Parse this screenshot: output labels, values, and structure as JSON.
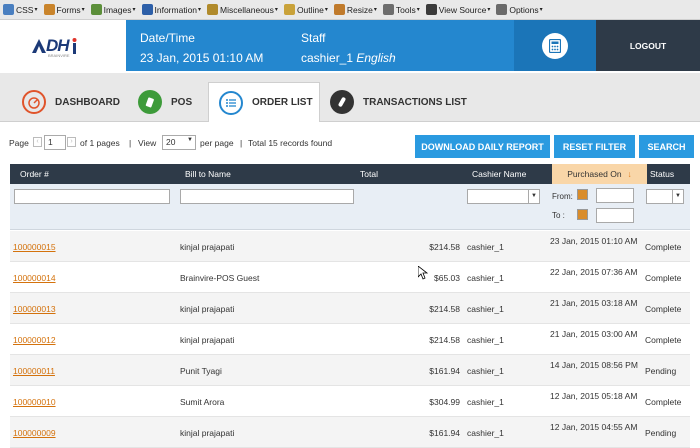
{
  "devbar": {
    "items": [
      {
        "label": "CSS",
        "icon": "css-icon",
        "color": "#4a7fc0"
      },
      {
        "label": "Forms",
        "icon": "forms-icon",
        "color": "#c9842b"
      },
      {
        "label": "Images",
        "icon": "images-icon",
        "color": "#5c8f3a"
      },
      {
        "label": "Information",
        "icon": "info-icon",
        "color": "#2d5fa8"
      },
      {
        "label": "Miscellaneous",
        "icon": "misc-icon",
        "color": "#b08a2b"
      },
      {
        "label": "Outline",
        "icon": "outline-icon",
        "color": "#c9a23a"
      },
      {
        "label": "Resize",
        "icon": "resize-icon",
        "color": "#c07a2b"
      },
      {
        "label": "Tools",
        "icon": "tools-icon",
        "color": "#6d6d6d"
      },
      {
        "label": "View Source",
        "icon": "view-source-icon",
        "color": "#3a3a3a"
      },
      {
        "label": "Options",
        "icon": "options-icon",
        "color": "#6a6a6a"
      }
    ]
  },
  "logo": {
    "text": "DH",
    "sub": "BRAINVIRE"
  },
  "header": {
    "date_label": "Date/Time",
    "date_value": "23 Jan, 2015 01:10 AM",
    "staff_label": "Staff",
    "staff_user": "cashier_1",
    "staff_lang": "English",
    "logout_label": "LOGOUT"
  },
  "tabs": [
    {
      "label": "DASHBOARD",
      "icon": "dashboard-icon"
    },
    {
      "label": "POS",
      "icon": "pos-icon"
    },
    {
      "label": "ORDER LIST",
      "icon": "order-list-icon",
      "active": true
    },
    {
      "label": "TRANSACTIONS LIST",
      "icon": "transactions-icon"
    }
  ],
  "pager": {
    "page_label": "Page",
    "page_value": "1",
    "of_pages": "of 1 pages",
    "view_label": "View",
    "view_value": "20",
    "per_page": "per page",
    "total": "Total 15 records found"
  },
  "buttons": {
    "download": "DOWNLOAD DAILY REPORT",
    "reset": "RESET FILTER",
    "search": "SEARCH"
  },
  "table": {
    "headers": {
      "order": "Order #",
      "bill": "Bill to Name",
      "total": "Total",
      "cashier": "Cashier Name",
      "purchased": "Purchased On",
      "status": "Status"
    },
    "filter": {
      "from": "From:",
      "to": "To :"
    },
    "rows": [
      {
        "order": "100000015",
        "bill": "kinjal prajapati",
        "total": "$214.58",
        "cashier": "cashier_1",
        "date": "23 Jan, 2015 01:10 AM",
        "status": "Complete"
      },
      {
        "order": "100000014",
        "bill": "Brainvire-POS Guest",
        "total": "$65.03",
        "cashier": "cashier_1",
        "date": "22 Jan, 2015 07:36 AM",
        "status": "Complete"
      },
      {
        "order": "100000013",
        "bill": "kinjal prajapati",
        "total": "$214.58",
        "cashier": "cashier_1",
        "date": "21 Jan, 2015 03:18 AM",
        "status": "Complete"
      },
      {
        "order": "100000012",
        "bill": "kinjal prajapati",
        "total": "$214.58",
        "cashier": "cashier_1",
        "date": "21 Jan, 2015 03:00 AM",
        "status": "Complete"
      },
      {
        "order": "100000011",
        "bill": "Punit Tyagi",
        "total": "$161.94",
        "cashier": "cashier_1",
        "date": "14 Jan, 2015 08:56 PM",
        "status": "Pending"
      },
      {
        "order": "100000010",
        "bill": "Sumit Arora",
        "total": "$304.99",
        "cashier": "cashier_1",
        "date": "12 Jan, 2015 05:18 AM",
        "status": "Complete"
      },
      {
        "order": "100000009",
        "bill": "kinjal prajapati",
        "total": "$161.94",
        "cashier": "cashier_1",
        "date": "12 Jan, 2015 04:55 AM",
        "status": "Pending"
      }
    ]
  }
}
